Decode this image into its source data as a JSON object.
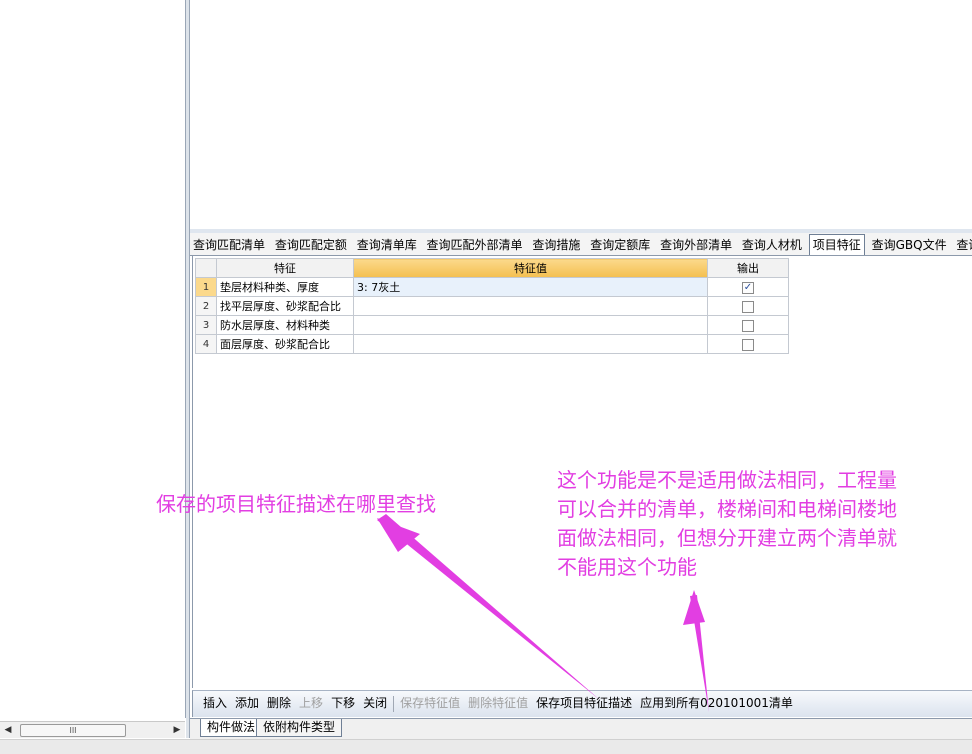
{
  "tabs": [
    {
      "label": "查询匹配清单"
    },
    {
      "label": "查询匹配定额"
    },
    {
      "label": "查询清单库"
    },
    {
      "label": "查询匹配外部清单"
    },
    {
      "label": "查询措施"
    },
    {
      "label": "查询定额库"
    },
    {
      "label": "查询外部清单"
    },
    {
      "label": "查询人材机"
    },
    {
      "label": "项目特征",
      "active": true
    },
    {
      "label": "查询GBQ文件"
    },
    {
      "label": "查询项目特"
    }
  ],
  "grid": {
    "headers": {
      "feature": "特征",
      "value": "特征值",
      "output": "输出"
    },
    "rows": [
      {
        "num": "1",
        "feature": "垫层材料种类、厚度",
        "value": "3: 7灰土",
        "output": true
      },
      {
        "num": "2",
        "feature": "找平层厚度、砂浆配合比",
        "value": "",
        "output": false
      },
      {
        "num": "3",
        "feature": "防水层厚度、材料种类",
        "value": "",
        "output": false
      },
      {
        "num": "4",
        "feature": "面层厚度、砂浆配合比",
        "value": "",
        "output": false
      }
    ]
  },
  "toolbar": {
    "insert": "插入",
    "add": "添加",
    "delete": "删除",
    "move_up": "上移",
    "move_down": "下移",
    "close": "关闭",
    "save_feature_value": "保存特征值",
    "delete_feature_value": "删除特征值",
    "save_item_feature_desc": "保存项目特征描述",
    "apply_to_all": "应用到所有020101001清单"
  },
  "bottom_tabs": {
    "component_method": "构件做法",
    "attached_component_type": "依附构件类型"
  },
  "scrollbar": {
    "thumb_grip": "III"
  },
  "annotations": {
    "question": "保存的项目特征描述在哪里查找",
    "comment_lines": [
      "这个功能是不是适用做法相同，工程量",
      "可以合并的清单，楼梯间和电梯间楼地",
      "面做法相同，但想分开建立两个清单就",
      "不能用这个功能"
    ]
  },
  "colors": {
    "annotation": "#e23ee2",
    "header_highlight": "#f4bf4f"
  }
}
